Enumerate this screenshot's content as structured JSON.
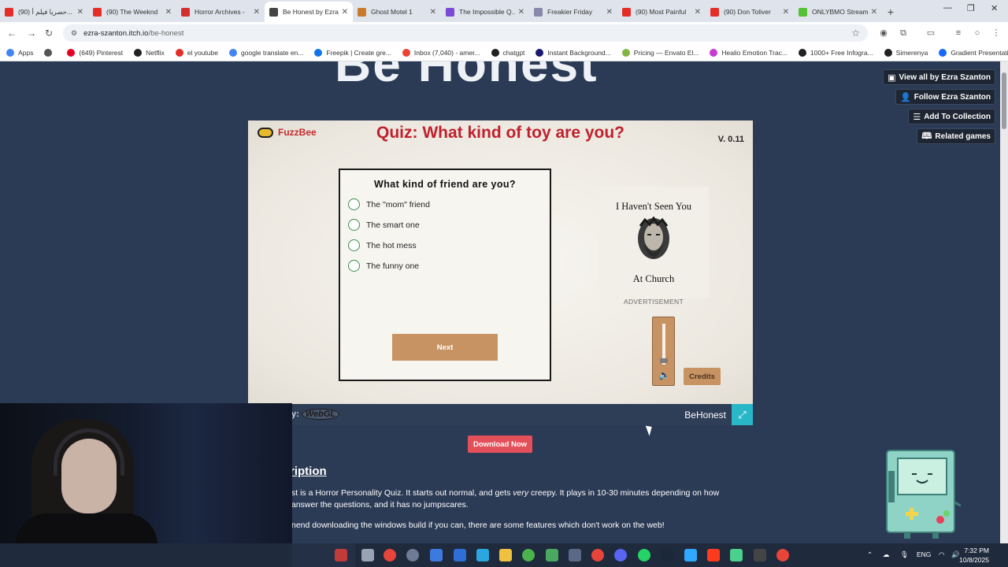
{
  "browser": {
    "tabs": [
      {
        "label": "(90) حصريا فيلم أ...",
        "color": "#e52d27"
      },
      {
        "label": "(90) The Weeknd",
        "color": "#e52d27"
      },
      {
        "label": "Horror Archives -",
        "color": "#d32f2f"
      },
      {
        "label": "Be Honest by Ezra",
        "color": "#444444",
        "active": true
      },
      {
        "label": "Ghost Motel 1",
        "color": "#c97b2b"
      },
      {
        "label": "The Impossible Q...",
        "color": "#7a4ad6"
      },
      {
        "label": "Freakier Friday",
        "color": "#8888aa"
      },
      {
        "label": "(90) Most Painful",
        "color": "#e52d27"
      },
      {
        "label": "(90) Don Toliver",
        "color": "#e52d27"
      },
      {
        "label": "ONLYBMO Stream",
        "color": "#53c234"
      }
    ],
    "new_tab": "+",
    "url_host": "ezra-szanton.itch.io",
    "url_path": "/be-honest",
    "bookmarks": [
      {
        "label": "Apps",
        "color": "#4285f4"
      },
      {
        "label": "",
        "color": "#555555"
      },
      {
        "label": "(649) Pinterest",
        "color": "#e60023"
      },
      {
        "label": "Netflix",
        "color": "#222222"
      },
      {
        "label": "el youtube",
        "color": "#e52d27"
      },
      {
        "label": "google translate en...",
        "color": "#4285f4"
      },
      {
        "label": "Freepik | Create gre...",
        "color": "#1273eb"
      },
      {
        "label": "Inbox (7,040) - amer...",
        "color": "#ea4335"
      },
      {
        "label": "chatgpt",
        "color": "#222222"
      },
      {
        "label": "Instant Background...",
        "color": "#1a1a6e"
      },
      {
        "label": "Pricing — Envato El...",
        "color": "#82b541"
      },
      {
        "label": "Healio Emotion Trac...",
        "color": "#c73bd1"
      },
      {
        "label": "1000+ Free Infogra...",
        "color": "#222222"
      },
      {
        "label": "Simerenya",
        "color": "#222222"
      },
      {
        "label": "Gradient Presentati...",
        "color": "#1769ff"
      }
    ]
  },
  "page": {
    "big_title": "Be Honest",
    "side_buttons": [
      {
        "icon": "itch-icon",
        "glyph": "▣",
        "label": "View all by Ezra Szanton"
      },
      {
        "icon": "follow-icon",
        "glyph": "👤",
        "label": "Follow Ezra Szanton"
      },
      {
        "icon": "add-collection-icon",
        "glyph": "☰",
        "label": "Add To Collection"
      },
      {
        "icon": "related-games-icon",
        "glyph": "🕮",
        "label": "Related games"
      }
    ],
    "game": {
      "brand": "FuzzBee",
      "title": "Quiz: What kind of toy are you?",
      "version": "V. 0.11",
      "question": "What kind of friend are you?",
      "options": [
        "The \"mom\" friend",
        "The smart one",
        "The hot mess",
        "The funny one"
      ],
      "next_label": "Next",
      "ad_line1": "I Haven't Seen You",
      "ad_line2": "At Church",
      "ad_label": "ADVERTISEMENT",
      "volume_level": 0.1,
      "credits_label": "Credits"
    },
    "footer": {
      "made_with": "y:",
      "engine": "WebGL",
      "game_name": "BeHonest"
    },
    "download_label": "Download Now",
    "description_heading": "ription",
    "description_p1a": "st is a Horror Personality Quiz. It starts out normal, and gets ",
    "description_p1b": "very",
    "description_p1c": " creepy. It plays in 10-30 minutes depending on how",
    "description_p2": "answer the questions, and it has no jumpscares.",
    "description_p3": "nend downloading the windows build if you can, there are some features which don't work on the web!"
  },
  "taskbar": {
    "lang": "ENG",
    "time": "7:32 PM",
    "date": "10/8/2025"
  }
}
